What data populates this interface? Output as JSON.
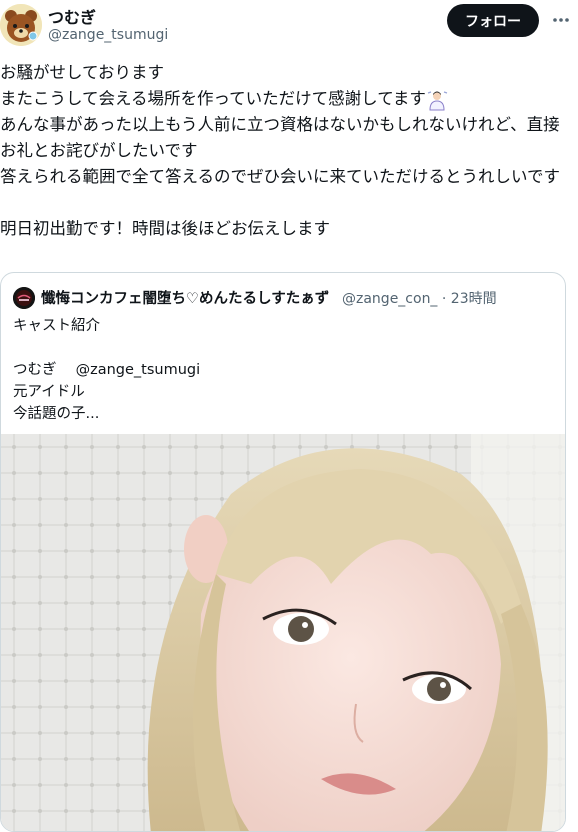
{
  "author": {
    "display_name": "つむぎ",
    "handle": "@zange_tsumugi",
    "avatar_icon": "bear-avatar-icon"
  },
  "follow_label": "フォロー",
  "more_icon": "more-options-icon",
  "tweet": {
    "lines": [
      "お騒がせしております",
      "またこうして会える場所を作っていただけて感謝してます",
      "あんな事があった以上もう人前に立つ資格はないかもしれないけれど、直接お礼とお詫びがしたいです",
      "答えられる範囲で全て答えるのでぜひ会いに来ていただけるとうれしいです",
      "",
      "明日初出勤です！時間は後ほどお伝えします"
    ],
    "emoji_icon": "person-bowing-emoji-icon"
  },
  "quote": {
    "display_name": "懺悔コンカフェ闇堕ち♡めんたるしすたぁず",
    "handle": "@zange_con_",
    "separator": "·",
    "time": "23時間",
    "body_lines": [
      "キャスト紹介",
      "",
      "つむぎ　 @zange_tsumugi",
      "元アイドル",
      "今話題の子..."
    ],
    "avatar_icon": "shop-logo-avatar-icon",
    "image_desc_icon": "selfie-photo-image"
  },
  "colors": {
    "text": "#0f1419",
    "secondary": "#536471",
    "border": "#cfd9de",
    "button_bg": "#0f1419",
    "hair": "#d8c9a3"
  }
}
